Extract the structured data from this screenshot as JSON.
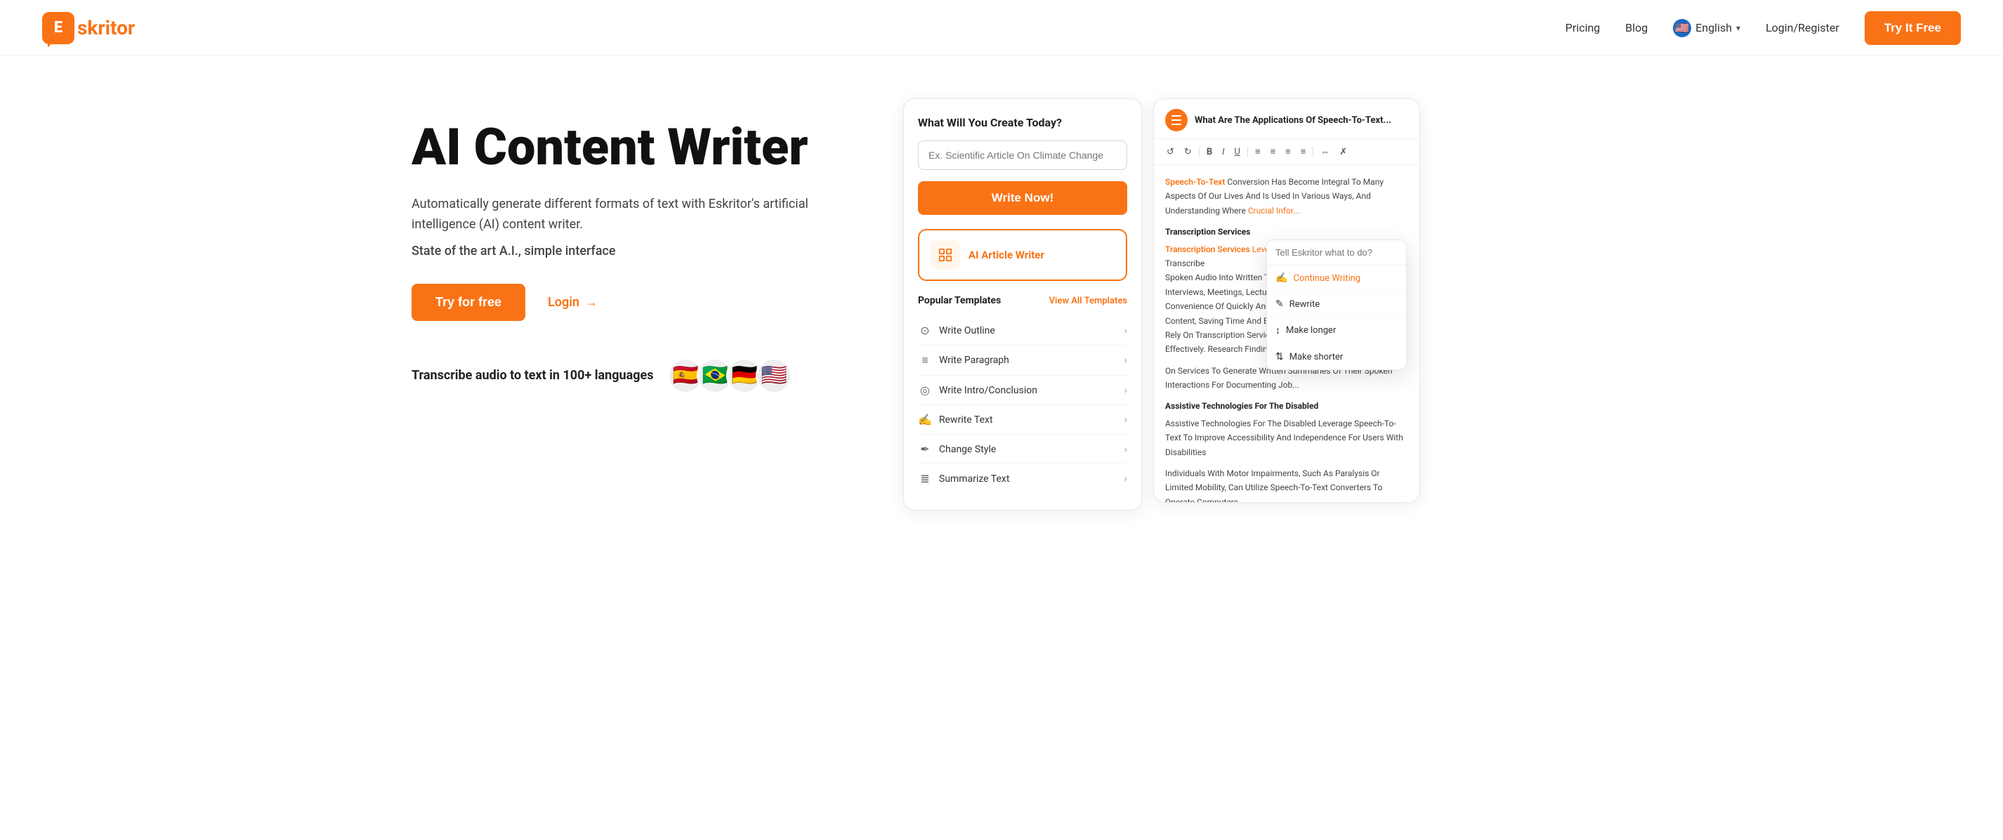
{
  "nav": {
    "logo_letter": "E",
    "logo_name": "skritor",
    "links": [
      "Pricing",
      "Blog"
    ],
    "lang": "English",
    "flag_emoji": "🇺🇸",
    "login_register": "Login/Register",
    "try_btn": "Try It Free"
  },
  "hero": {
    "title": "AI Content Writer",
    "desc": "Automatically generate different formats of text with Eskritor's artificial intelligence (AI) content writer.",
    "sub": "State of the art A.I., simple interface",
    "try_btn": "Try for free",
    "login_btn": "Login",
    "transcribe_text": "Transcribe audio to text in 100+ languages",
    "flags": [
      "🇪🇸",
      "🇧🇷",
      "🇩🇪",
      "🇺🇸"
    ]
  },
  "left_panel": {
    "title": "What Will You Create Today?",
    "input_placeholder": "Ex. Scientific Article On Climate Change",
    "write_btn": "Write Now!",
    "ai_card_label": "AI Article Writer",
    "popular_templates_title": "Popular Templates",
    "view_all": "View All Templates",
    "templates": [
      {
        "icon": "⊙",
        "name": "Write Outline"
      },
      {
        "icon": "≡",
        "name": "Write Paragraph"
      },
      {
        "icon": "◎",
        "name": "Write Intro/Conclusion"
      },
      {
        "icon": "✍",
        "name": "Rewrite Text"
      },
      {
        "icon": "✒",
        "name": "Change Style"
      },
      {
        "icon": "≣",
        "name": "Summarize Text"
      }
    ]
  },
  "right_panel": {
    "title": "What Are The Applications Of Speech-To-Text...",
    "toolbar": [
      "↺",
      "↻",
      "B",
      "I",
      "U",
      "≡",
      "≡",
      "≡",
      "≡",
      "⇔",
      "✗"
    ],
    "content_intro": "Speech-To-Text Conversion Has Become Integral To Many Aspects Of Our Lives And Is Used In Various Ways, And Understanding Where Crucial Information...",
    "section1_title": "Transcription Services",
    "section1_body": "Transcription Services Leverage Speech-To-Text Conversion To Transcribe Spoken Audio Into Written Text Efficiently. Editors Benefit From Transcriptions During Interviews, Meetings, Lectures And Personal Notes As It Has The Convenience Of Quickly And Accurately Converting Spoken Content, Saving Time And Effort. Transcription Services Also Rely On Transcription Services To Process Audio Data Effectively. Research Findings",
    "section2_body": "On Services To Generate Written Summaries Of Their Spoken Interactions For Documenting Job...",
    "section3_title": "Assistive Technologies For The Disabled",
    "section3_body": "Assistive Technologies For The Disabled Leverage Speech-To-Text To Improve Accessibility And Independence For Users With Disabilities",
    "section4_body": "Individuals With Motor Impairments, Such As Paralysis Or Limited Mobility, Can Utilize Speech-To-Text Converters To Operate Computers..."
  },
  "dropdown": {
    "placeholder": "Tell Eskritor what to do?",
    "items": [
      {
        "icon": "✍",
        "label": "Continue Writing"
      },
      {
        "icon": "✎",
        "label": "Rewrite"
      },
      {
        "icon": "⬆",
        "label": "Make longer"
      },
      {
        "icon": "⬇",
        "label": "Make shorter"
      }
    ]
  }
}
